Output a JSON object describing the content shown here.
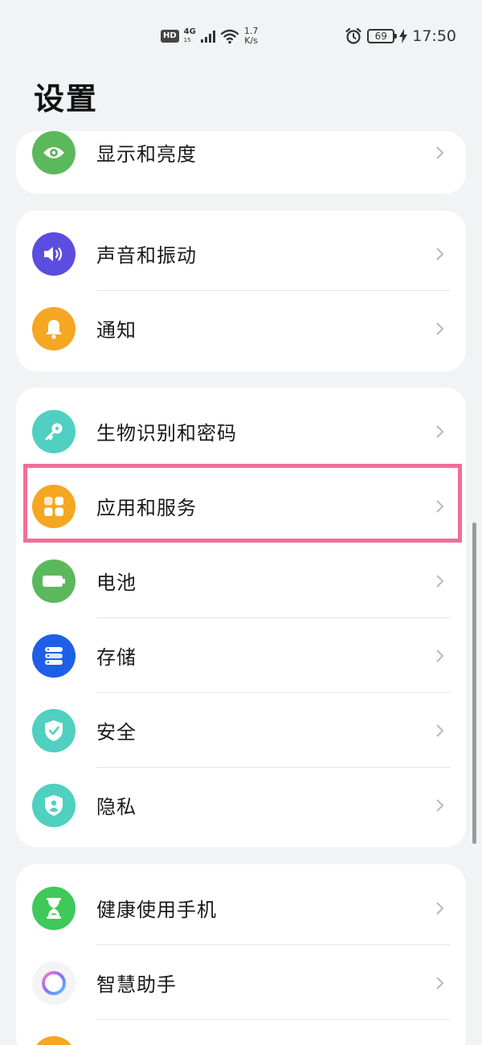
{
  "status_bar": {
    "hd": "HD",
    "network": "4G",
    "network_sub": "15",
    "speed_value": "1.7",
    "speed_unit": "K/s",
    "battery": "69",
    "time": "17:50"
  },
  "page": {
    "title": "设置"
  },
  "sections": [
    {
      "items": [
        {
          "label": "显示和亮度",
          "icon": "eye-icon",
          "color": "#5cb85c"
        }
      ]
    },
    {
      "items": [
        {
          "label": "声音和振动",
          "icon": "speaker-icon",
          "color": "#5b4de0"
        },
        {
          "label": "通知",
          "icon": "bell-icon",
          "color": "#f5a623"
        }
      ]
    },
    {
      "items": [
        {
          "label": "生物识别和密码",
          "icon": "key-icon",
          "color": "#4fd0c0"
        },
        {
          "label": "应用和服务",
          "icon": "apps-grid-icon",
          "color": "#f5a623"
        },
        {
          "label": "电池",
          "icon": "battery-icon",
          "color": "#5cb85c"
        },
        {
          "label": "存储",
          "icon": "storage-icon",
          "color": "#1f5fe8"
        },
        {
          "label": "安全",
          "icon": "shield-check-icon",
          "color": "#4fd0c0"
        },
        {
          "label": "隐私",
          "icon": "privacy-shield-icon",
          "color": "#4fd0c0"
        }
      ]
    },
    {
      "items": [
        {
          "label": "健康使用手机",
          "icon": "hourglass-icon",
          "color": "#3fc95a"
        },
        {
          "label": "智慧助手",
          "icon": "assistant-ring-icon",
          "color": "#ffffff"
        }
      ]
    }
  ],
  "highlight_target": "应用和服务"
}
